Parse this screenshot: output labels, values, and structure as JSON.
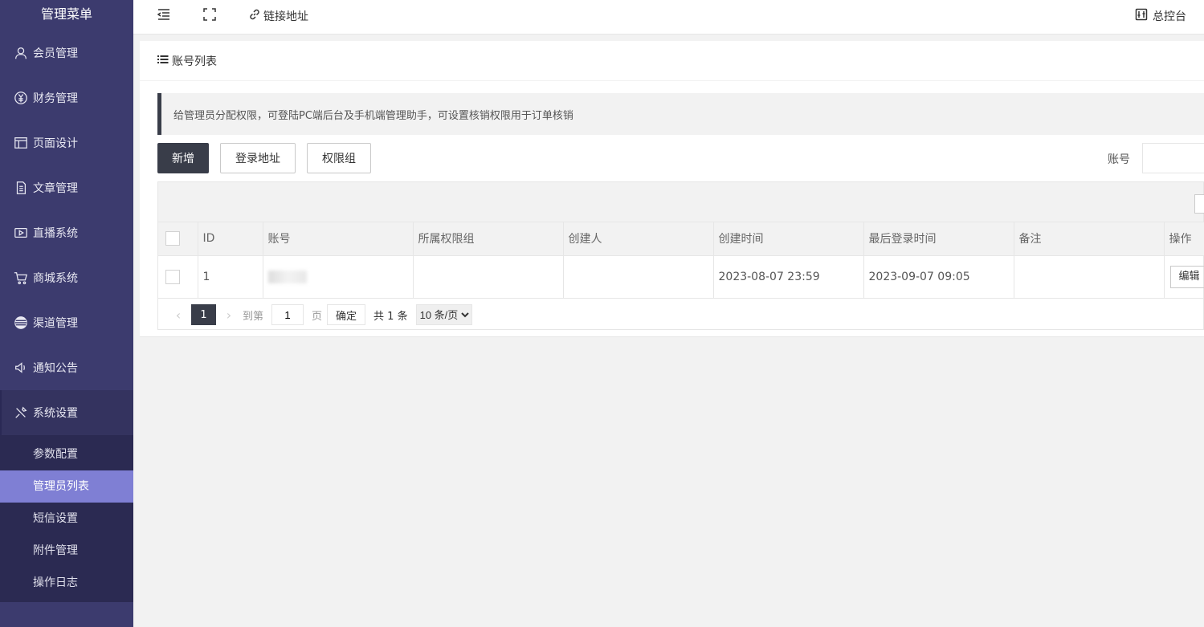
{
  "sidebar": {
    "title": "管理菜单",
    "items": [
      {
        "label": "会员管理",
        "icon": "user-icon"
      },
      {
        "label": "财务管理",
        "icon": "yen-icon"
      },
      {
        "label": "页面设计",
        "icon": "layout-icon"
      },
      {
        "label": "文章管理",
        "icon": "document-icon"
      },
      {
        "label": "直播系统",
        "icon": "video-icon"
      },
      {
        "label": "商城系统",
        "icon": "cart-icon"
      },
      {
        "label": "渠道管理",
        "icon": "channel-icon"
      },
      {
        "label": "通知公告",
        "icon": "speaker-icon"
      },
      {
        "label": "系统设置",
        "icon": "tools-icon"
      }
    ],
    "submenu": [
      "参数配置",
      "管理员列表",
      "短信设置",
      "附件管理",
      "操作日志"
    ],
    "selected_sub": "管理员列表"
  },
  "header": {
    "link_label": "链接地址",
    "dashboard_label": "总控台"
  },
  "card": {
    "title": "账号列表",
    "notice": "给管理员分配权限，可登陆PC端后台及手机端管理助手，可设置核销权限用于订单核销",
    "buttons": {
      "add": "新增",
      "login_url": "登录地址",
      "perm_group": "权限组"
    },
    "search_label": "账号"
  },
  "table": {
    "columns": [
      "ID",
      "账号",
      "所属权限组",
      "创建人",
      "创建时间",
      "最后登录时间",
      "备注",
      "操作"
    ],
    "rows": [
      {
        "id": "1",
        "account": "",
        "group": "",
        "creator": "",
        "created": "2023-08-07 23:59",
        "last_login": "2023-09-07 09:05",
        "note": "",
        "action": "编辑"
      }
    ]
  },
  "pager": {
    "current": "1",
    "goto_label": "到第",
    "goto_value": "1",
    "page_label": "页",
    "confirm": "确定",
    "total": "共 1 条",
    "page_size": "10 条/页"
  },
  "colors": {
    "sidebar_bg": "#3c3b6e",
    "selected_sub": "#7f7fd4",
    "dark_btn": "#393d49"
  }
}
